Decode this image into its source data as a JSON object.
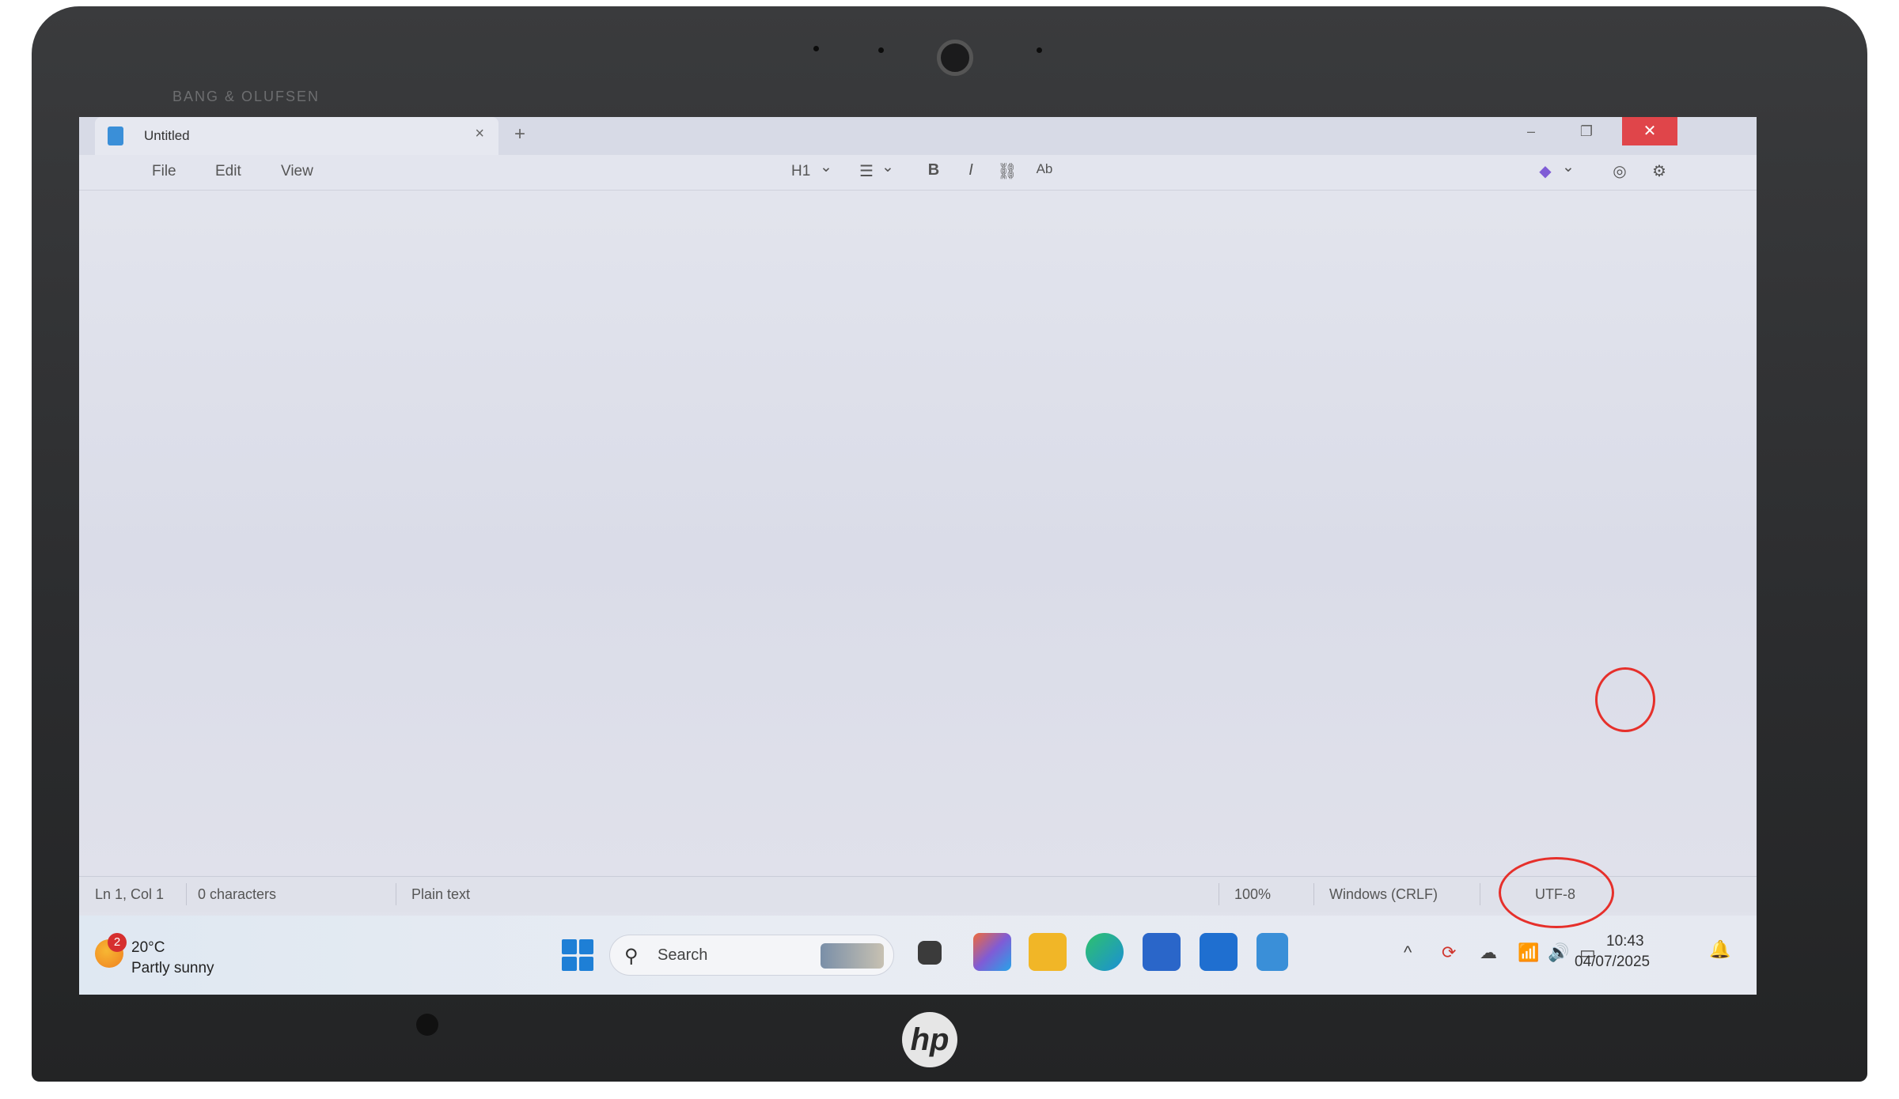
{
  "hardware": {
    "bezel_brand": "BANG & OLUFSEN",
    "logo": "hp"
  },
  "window": {
    "tab_title": "Untitled",
    "tab_close_icon": "×",
    "new_tab_icon": "+",
    "minimize": "–",
    "maximize": "❐",
    "close": "✕"
  },
  "menu": {
    "file": "File",
    "edit": "Edit",
    "view": "View"
  },
  "toolbar": {
    "heading": "H1",
    "heading_chevron": "⌄",
    "list_icon": "☰",
    "list_chevron": "⌄",
    "bold": "B",
    "italic": "I",
    "link_icon": "⛓",
    "spell_icon": "Ab",
    "copilot_chevron": "⌄",
    "account_icon": "◎",
    "settings_icon": "⚙"
  },
  "statusbar": {
    "position": "Ln 1, Col 1",
    "characters": "0 characters",
    "format": "Plain text",
    "zoom": "100%",
    "line_ending": "Windows (CRLF)",
    "encoding": "UTF-8"
  },
  "taskbar": {
    "weather_badge": "2",
    "weather_temp": "20°C",
    "weather_desc": "Partly sunny",
    "search_placeholder": "Search",
    "search_icon": "⚲",
    "tray_chevron": "^",
    "time": "10:43",
    "date": "04/07/2025",
    "bell_icon": "🔔",
    "apps": [
      {
        "name": "task-view",
        "color": "#3b3b3b"
      },
      {
        "name": "copilot",
        "color": "#7f5cd6"
      },
      {
        "name": "file-explorer",
        "color": "#f1b627"
      },
      {
        "name": "edge",
        "color": "#1b8fd6"
      },
      {
        "name": "store",
        "color": "#2a66c9"
      },
      {
        "name": "outlook",
        "color": "#1f6fd0"
      },
      {
        "name": "notepad",
        "color": "#3a8fd8"
      }
    ]
  }
}
